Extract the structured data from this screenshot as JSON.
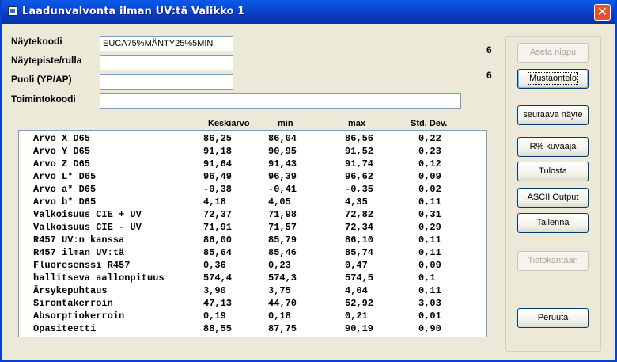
{
  "window": {
    "title": "Laadunvalvonta ilman UV:tä  Valikko 1",
    "close_glyph": "✕"
  },
  "form": {
    "naytekoodi": {
      "label": "Näytekoodi",
      "value": "EUCA75%MÄNTY25%5MIN"
    },
    "naytepiste": {
      "label": "Näytepiste/rulla",
      "value": ""
    },
    "puoli": {
      "label": "Puoli (YP/AP)",
      "value": ""
    },
    "toimintokoodi": {
      "label": "Toimintokoodi",
      "value": ""
    }
  },
  "counts": {
    "first": "6",
    "second": "6"
  },
  "buttons": {
    "aseta_nippu": "Aseta nippu",
    "mustaontelo": "Mustaontelo",
    "seuraava_nayte": "seuraava näyte",
    "r_kuvaaja": "R% kuvaaja",
    "tulosta": "Tulosta",
    "ascii_output": "ASCII Output",
    "tallenna": "Tallenna",
    "tietokantaan": "Tietokantaan",
    "peruuta": "Peruuta"
  },
  "table": {
    "headers": {
      "avg": "Keskiarvo",
      "min": "min",
      "max": "max",
      "std": "Std. Dev."
    },
    "rows": [
      {
        "name": "Arvo X D65",
        "avg": "86,25",
        "min": "86,04",
        "max": "86,56",
        "std": "0,22"
      },
      {
        "name": "Arvo Y D65",
        "avg": "91,18",
        "min": "90,95",
        "max": "91,52",
        "std": "0,23"
      },
      {
        "name": "Arvo Z D65",
        "avg": "91,64",
        "min": "91,43",
        "max": "91,74",
        "std": "0,12"
      },
      {
        "name": "Arvo L* D65",
        "avg": "96,49",
        "min": "96,39",
        "max": "96,62",
        "std": "0,09"
      },
      {
        "name": "Arvo a* D65",
        "avg": "-0,38",
        "min": "-0,41",
        "max": "-0,35",
        "std": "0,02"
      },
      {
        "name": "Arvo b* D65",
        "avg": "4,18",
        "min": "4,05",
        "max": "4,35",
        "std": "0,11"
      },
      {
        "name": "Valkoisuus CIE + UV",
        "avg": "72,37",
        "min": "71,98",
        "max": "72,82",
        "std": "0,31"
      },
      {
        "name": "Valkoisuus CIE - UV",
        "avg": "71,91",
        "min": "71,57",
        "max": "72,34",
        "std": "0,29"
      },
      {
        "name": "R457 UV:n kanssa",
        "avg": "86,00",
        "min": "85,79",
        "max": "86,10",
        "std": "0,11"
      },
      {
        "name": "R457 ilman UV:tä",
        "avg": "85,64",
        "min": "85,46",
        "max": "85,74",
        "std": "0,11"
      },
      {
        "name": "Fluoresenssi R457",
        "avg": "0,36",
        "min": "0,23",
        "max": "0,47",
        "std": "0,09"
      },
      {
        "name": "hallitseva aallonpituus",
        "avg": "574,4",
        "min": "574,3",
        "max": "574,5",
        "std": "0,1"
      },
      {
        "name": "Ärsykepuhtaus",
        "avg": "3,90",
        "min": "3,75",
        "max": "4,04",
        "std": "0,11"
      },
      {
        "name": "Sirontakerroin",
        "avg": "47,13",
        "min": "44,70",
        "max": "52,92",
        "std": "3,03"
      },
      {
        "name": "Absorptiokerroin",
        "avg": "0,19",
        "min": "0,18",
        "max": "0,21",
        "std": "0,01"
      },
      {
        "name": "Opasiteetti",
        "avg": "88,55",
        "min": "87,75",
        "max": "90,19",
        "std": "0,90"
      }
    ]
  }
}
